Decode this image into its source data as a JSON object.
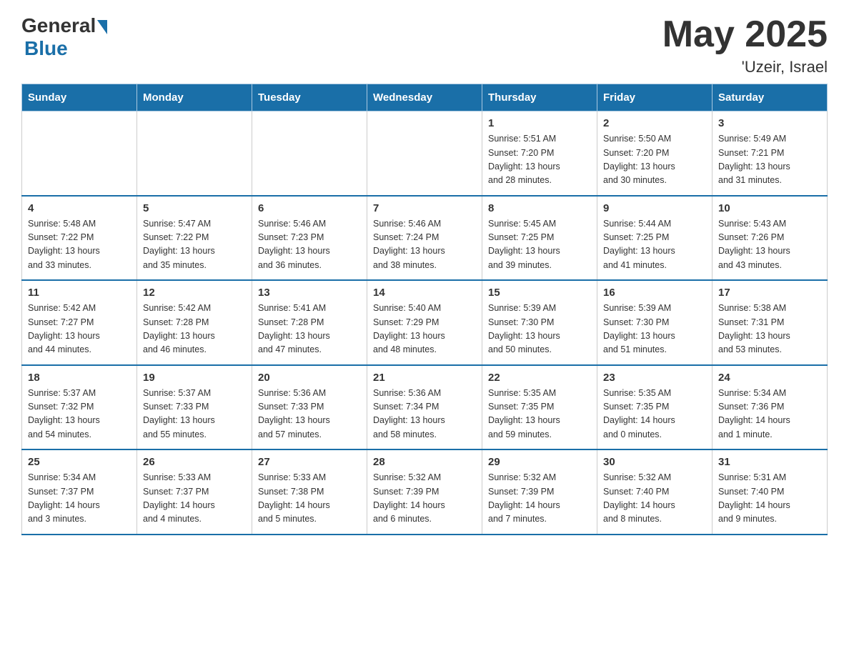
{
  "header": {
    "logo_general": "General",
    "logo_blue": "Blue",
    "month_year": "May 2025",
    "location": "'Uzeir, Israel"
  },
  "weekdays": [
    "Sunday",
    "Monday",
    "Tuesday",
    "Wednesday",
    "Thursday",
    "Friday",
    "Saturday"
  ],
  "weeks": [
    [
      {
        "day": "",
        "info": ""
      },
      {
        "day": "",
        "info": ""
      },
      {
        "day": "",
        "info": ""
      },
      {
        "day": "",
        "info": ""
      },
      {
        "day": "1",
        "info": "Sunrise: 5:51 AM\nSunset: 7:20 PM\nDaylight: 13 hours\nand 28 minutes."
      },
      {
        "day": "2",
        "info": "Sunrise: 5:50 AM\nSunset: 7:20 PM\nDaylight: 13 hours\nand 30 minutes."
      },
      {
        "day": "3",
        "info": "Sunrise: 5:49 AM\nSunset: 7:21 PM\nDaylight: 13 hours\nand 31 minutes."
      }
    ],
    [
      {
        "day": "4",
        "info": "Sunrise: 5:48 AM\nSunset: 7:22 PM\nDaylight: 13 hours\nand 33 minutes."
      },
      {
        "day": "5",
        "info": "Sunrise: 5:47 AM\nSunset: 7:22 PM\nDaylight: 13 hours\nand 35 minutes."
      },
      {
        "day": "6",
        "info": "Sunrise: 5:46 AM\nSunset: 7:23 PM\nDaylight: 13 hours\nand 36 minutes."
      },
      {
        "day": "7",
        "info": "Sunrise: 5:46 AM\nSunset: 7:24 PM\nDaylight: 13 hours\nand 38 minutes."
      },
      {
        "day": "8",
        "info": "Sunrise: 5:45 AM\nSunset: 7:25 PM\nDaylight: 13 hours\nand 39 minutes."
      },
      {
        "day": "9",
        "info": "Sunrise: 5:44 AM\nSunset: 7:25 PM\nDaylight: 13 hours\nand 41 minutes."
      },
      {
        "day": "10",
        "info": "Sunrise: 5:43 AM\nSunset: 7:26 PM\nDaylight: 13 hours\nand 43 minutes."
      }
    ],
    [
      {
        "day": "11",
        "info": "Sunrise: 5:42 AM\nSunset: 7:27 PM\nDaylight: 13 hours\nand 44 minutes."
      },
      {
        "day": "12",
        "info": "Sunrise: 5:42 AM\nSunset: 7:28 PM\nDaylight: 13 hours\nand 46 minutes."
      },
      {
        "day": "13",
        "info": "Sunrise: 5:41 AM\nSunset: 7:28 PM\nDaylight: 13 hours\nand 47 minutes."
      },
      {
        "day": "14",
        "info": "Sunrise: 5:40 AM\nSunset: 7:29 PM\nDaylight: 13 hours\nand 48 minutes."
      },
      {
        "day": "15",
        "info": "Sunrise: 5:39 AM\nSunset: 7:30 PM\nDaylight: 13 hours\nand 50 minutes."
      },
      {
        "day": "16",
        "info": "Sunrise: 5:39 AM\nSunset: 7:30 PM\nDaylight: 13 hours\nand 51 minutes."
      },
      {
        "day": "17",
        "info": "Sunrise: 5:38 AM\nSunset: 7:31 PM\nDaylight: 13 hours\nand 53 minutes."
      }
    ],
    [
      {
        "day": "18",
        "info": "Sunrise: 5:37 AM\nSunset: 7:32 PM\nDaylight: 13 hours\nand 54 minutes."
      },
      {
        "day": "19",
        "info": "Sunrise: 5:37 AM\nSunset: 7:33 PM\nDaylight: 13 hours\nand 55 minutes."
      },
      {
        "day": "20",
        "info": "Sunrise: 5:36 AM\nSunset: 7:33 PM\nDaylight: 13 hours\nand 57 minutes."
      },
      {
        "day": "21",
        "info": "Sunrise: 5:36 AM\nSunset: 7:34 PM\nDaylight: 13 hours\nand 58 minutes."
      },
      {
        "day": "22",
        "info": "Sunrise: 5:35 AM\nSunset: 7:35 PM\nDaylight: 13 hours\nand 59 minutes."
      },
      {
        "day": "23",
        "info": "Sunrise: 5:35 AM\nSunset: 7:35 PM\nDaylight: 14 hours\nand 0 minutes."
      },
      {
        "day": "24",
        "info": "Sunrise: 5:34 AM\nSunset: 7:36 PM\nDaylight: 14 hours\nand 1 minute."
      }
    ],
    [
      {
        "day": "25",
        "info": "Sunrise: 5:34 AM\nSunset: 7:37 PM\nDaylight: 14 hours\nand 3 minutes."
      },
      {
        "day": "26",
        "info": "Sunrise: 5:33 AM\nSunset: 7:37 PM\nDaylight: 14 hours\nand 4 minutes."
      },
      {
        "day": "27",
        "info": "Sunrise: 5:33 AM\nSunset: 7:38 PM\nDaylight: 14 hours\nand 5 minutes."
      },
      {
        "day": "28",
        "info": "Sunrise: 5:32 AM\nSunset: 7:39 PM\nDaylight: 14 hours\nand 6 minutes."
      },
      {
        "day": "29",
        "info": "Sunrise: 5:32 AM\nSunset: 7:39 PM\nDaylight: 14 hours\nand 7 minutes."
      },
      {
        "day": "30",
        "info": "Sunrise: 5:32 AM\nSunset: 7:40 PM\nDaylight: 14 hours\nand 8 minutes."
      },
      {
        "day": "31",
        "info": "Sunrise: 5:31 AM\nSunset: 7:40 PM\nDaylight: 14 hours\nand 9 minutes."
      }
    ]
  ]
}
